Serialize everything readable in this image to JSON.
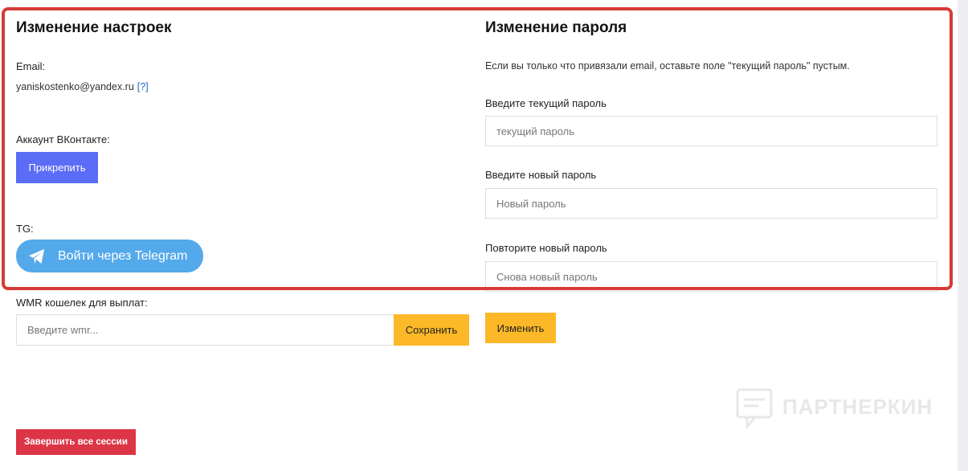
{
  "settings": {
    "title": "Изменение настроек",
    "email_label": "Email:",
    "email_value": "yaniskostenko@yandex.ru",
    "email_help": "[?]",
    "vk_label": "Аккаунт ВКонтакте:",
    "vk_button": "Прикрепить",
    "tg_label": "TG:",
    "tg_button": "Войти через Telegram",
    "wmr_label": "WMR кошелек для выплат:",
    "wmr_placeholder": "Введите wmr...",
    "wmr_save": "Сохранить",
    "end_sessions": "Завершить все сессии"
  },
  "password": {
    "title": "Изменение пароля",
    "note": "Если вы только что привязали email, оставьте поле \"текущий пароль\" пустым.",
    "current_label": "Введите текущий пароль",
    "current_placeholder": "текущий пароль",
    "new_label": "Введите новый пароль",
    "new_placeholder": "Новый пароль",
    "repeat_label": "Повторите новый пароль",
    "repeat_placeholder": "Снова новый пароль",
    "change_button": "Изменить"
  },
  "watermark": {
    "text": "ПАРТНЕРКИН"
  },
  "colors": {
    "highlight": "#d63b37",
    "blue_button": "#5b6cf6",
    "telegram": "#54a9eb",
    "yellow_button": "#fcb827",
    "red_button": "#dc3545"
  },
  "icons": {
    "telegram": "telegram-plane-icon",
    "watermark_logo": "partnerkin-logo-icon"
  }
}
